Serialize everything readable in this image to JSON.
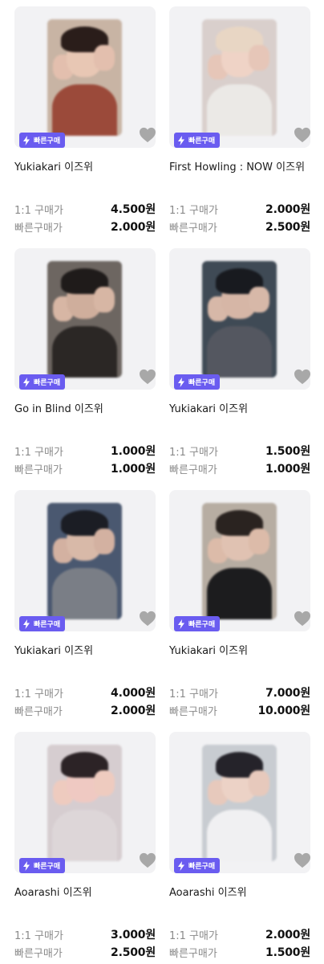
{
  "badge_label": "빠른구매",
  "price_labels": {
    "one_to_one": "1:1 구매가",
    "quick": "빠른구매가"
  },
  "products": [
    {
      "title": "Yukiakari 이즈위",
      "price_1to1": "4.500원",
      "price_quick": "2.000원",
      "photo": {
        "bg": "#c8b4a4",
        "hair": "#2a1d1a",
        "face": "#e8c7b4",
        "body": "#9b4a3a",
        "hand": "#e3bfae"
      }
    },
    {
      "title": "First Howling : NOW 이즈위",
      "price_1to1": "2.000원",
      "price_quick": "2.500원",
      "photo": {
        "bg": "#d9cfcc",
        "hair": "#e8d6c4",
        "face": "#efd3c6",
        "body": "#ebe9e6",
        "hand": "#e6c6b8"
      }
    },
    {
      "title": "Go in Blind 이즈위",
      "price_1to1": "1.000원",
      "price_quick": "1.000원",
      "photo": {
        "bg": "#6d6661",
        "hair": "#1f1b1a",
        "face": "#cfae9c",
        "body": "#2b2725",
        "hand": "#d7b6a4"
      }
    },
    {
      "title": "Yukiakari 이즈위",
      "price_1to1": "1.500원",
      "price_quick": "1.000원",
      "photo": {
        "bg": "#3f4a55",
        "hair": "#181a1f",
        "face": "#d6b6a6",
        "body": "#545760",
        "hand": "#d7b8a8"
      }
    },
    {
      "title": "Yukiakari 이즈위",
      "price_1to1": "4.000원",
      "price_quick": "2.000원",
      "photo": {
        "bg": "#4a5870",
        "hair": "#1b1d24",
        "face": "#d8b9a8",
        "body": "#7a7e86",
        "hand": "#d3b1a1"
      }
    },
    {
      "title": "Yukiakari 이즈위",
      "price_1to1": "7.000원",
      "price_quick": "10.000원",
      "photo": {
        "bg": "#b7ada2",
        "hair": "#2a2320",
        "face": "#e0c2b2",
        "body": "#1c1c1e",
        "hand": "#dcbba9"
      }
    },
    {
      "title": "Aoarashi 이즈위",
      "price_1to1": "3.000원",
      "price_quick": "2.500원",
      "photo": {
        "bg": "#d6cdd0",
        "hair": "#2c2326",
        "face": "#efc9c2",
        "body": "#ddd6d8",
        "hand": "#eecbbf"
      }
    },
    {
      "title": "Aoarashi 이즈위",
      "price_1to1": "2.000원",
      "price_quick": "1.500원",
      "photo": {
        "bg": "#c8ccd1",
        "hair": "#25232a",
        "face": "#ecd2c6",
        "body": "#f0f0f2",
        "hand": "#e7c9bc"
      }
    }
  ],
  "colors": {
    "badge": "#6a5cf0",
    "heart": "#a8a8a8",
    "thumb_bg": "#f2f2f4"
  }
}
